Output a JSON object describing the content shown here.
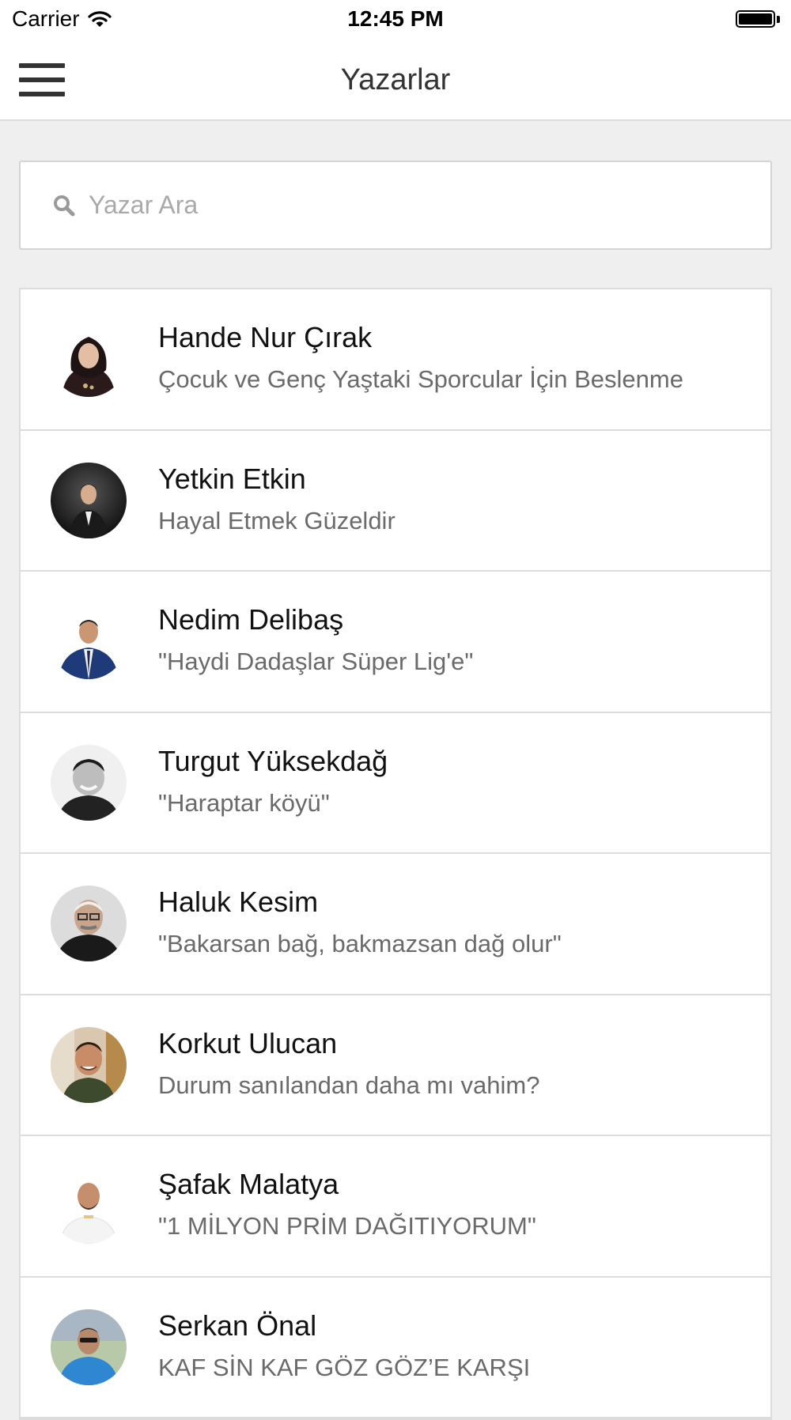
{
  "status_bar": {
    "carrier": "Carrier",
    "time": "12:45 PM"
  },
  "nav": {
    "title": "Yazarlar",
    "menu_icon": "hamburger-menu-icon"
  },
  "search": {
    "placeholder": "Yazar Ara",
    "value": "",
    "icon": "search-icon"
  },
  "authors": [
    {
      "name": "Hande Nur Çırak",
      "subtitle": "Çocuk ve Genç Yaştaki Sporcular İçin Beslenme"
    },
    {
      "name": "Yetkin Etkin",
      "subtitle": "Hayal Etmek Güzeldir"
    },
    {
      "name": "Nedim Delibaş",
      "subtitle": "\"Haydi Dadaşlar Süper Lig'e\""
    },
    {
      "name": "Turgut Yüksekdağ",
      "subtitle": "\"Haraptar köyü\""
    },
    {
      "name": "Haluk Kesim",
      "subtitle": "\"Bakarsan bağ, bakmazsan dağ olur\""
    },
    {
      "name": "Korkut Ulucan",
      "subtitle": "Durum sanılandan daha mı vahim?"
    },
    {
      "name": "Şafak Malatya",
      "subtitle": "\"1 MİLYON PRİM DAĞITIYORUM\""
    },
    {
      "name": "Serkan Önal",
      "subtitle": "KAF SİN KAF  GÖZ GÖZ’E KARŞI"
    }
  ]
}
